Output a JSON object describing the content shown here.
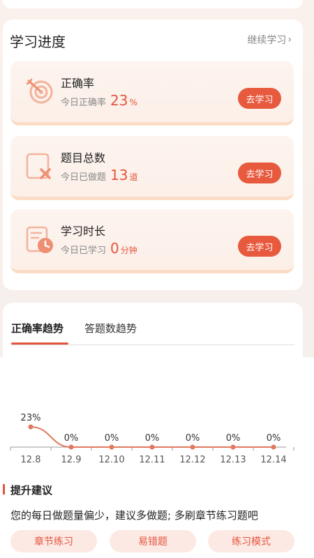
{
  "progress": {
    "title": "学习进度",
    "continue_label": "继续学习",
    "items": [
      {
        "label": "正确率",
        "sub": "今日正确率",
        "value": "23",
        "unit": "%",
        "button": "去学习",
        "icon": "target-icon"
      },
      {
        "label": "题目总数",
        "sub": "今日已做题",
        "value": "13",
        "unit": "道",
        "button": "去学习",
        "icon": "question-x-icon"
      },
      {
        "label": "学习时长",
        "sub": "今日已学习",
        "value": "0",
        "unit": "分钟",
        "button": "去学习",
        "icon": "clock-doc-icon"
      }
    ]
  },
  "trend": {
    "tabs": [
      "正确率趋势",
      "答题数趋势"
    ],
    "active_tab": 0
  },
  "chart_data": {
    "type": "line",
    "categories": [
      "12.8",
      "12.9",
      "12.10",
      "12.11",
      "12.12",
      "12.13",
      "12.14"
    ],
    "values": [
      23,
      0,
      0,
      0,
      0,
      0,
      0
    ],
    "data_labels": [
      "23%",
      "0%",
      "0%",
      "0%",
      "0%",
      "0%",
      "0%"
    ],
    "title": "",
    "xlabel": "",
    "ylabel": "",
    "ylim": [
      0,
      23
    ],
    "grid": false,
    "line_color": "#e07a5f",
    "point_color": "#e07a5f"
  },
  "advice": {
    "title": "提升建议",
    "text": "您的每日做题量偏少，建议多做题; 多刷章节练习题吧",
    "buttons": [
      "章节练习",
      "易错题",
      "练习模式"
    ]
  },
  "colors": {
    "accent": "#e4553e",
    "button": "#e85a3e",
    "pill_bg": "#fde9e4"
  }
}
